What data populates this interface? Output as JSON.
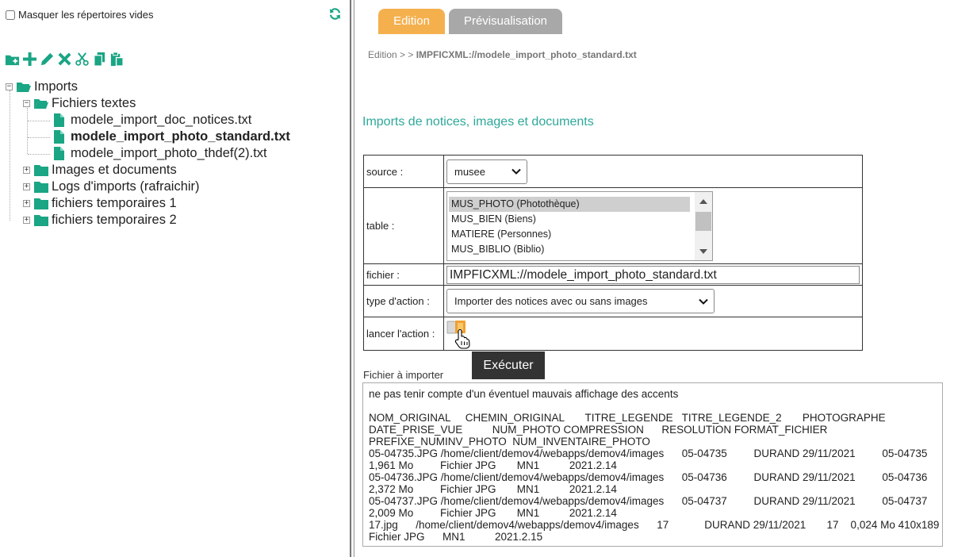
{
  "left_panel": {
    "hide_empty_label": "Masquer les répertoires vides",
    "toolbar_icons": [
      "new-folder-icon",
      "add-icon",
      "edit-icon",
      "delete-icon",
      "cut-icon",
      "copy-icon",
      "paste-icon"
    ],
    "tree": {
      "root": "Imports",
      "text_files_folder": "Fichiers textes",
      "files": [
        "modele_import_doc_notices.txt",
        "modele_import_photo_standard.txt",
        "modele_import_photo_thdef(2).txt"
      ],
      "other_folders": [
        "Images et documents",
        "Logs d'imports (rafraichir)",
        "fichiers temporaires 1",
        "fichiers temporaires 2"
      ]
    }
  },
  "tabs": {
    "edit": "Edition",
    "preview": "Prévisualisation"
  },
  "breadcrumb": {
    "prefix": "Edition > >",
    "current": "IMPFICXML://modele_import_photo_standard.txt"
  },
  "section_title": "Imports de notices, images et documents",
  "form": {
    "source_label": "source :",
    "source_value": "musee",
    "table_label": "table :",
    "table_options": [
      "MUS_PHOTO (Photothèque)",
      "MUS_BIEN (Biens)",
      "MATIERE (Personnes)",
      "MUS_BIBLIO (Biblio)"
    ],
    "file_label": "fichier :",
    "file_value": "IMPFICXML://modele_import_photo_standard.txt",
    "action_type_label": "type d'action :",
    "action_type_value": "Importer des notices avec ou sans images",
    "launch_label": "lancer l'action :"
  },
  "tooltip": "Exécuter",
  "file_to_import": {
    "label": "Fichier à importer",
    "lines": [
      "ne pas tenir compte d'un éventuel mauvais affichage des accents",
      "",
      "NOM_ORIGINAL     CHEMIN_ORIGINAL       TITRE_LEGENDE   TITRE_LEGENDE_2       PHOTOGRAPHE",
      "DATE_PRISE_VUE          NUM_PHOTO COMPRESSION      RESOLUTION FORMAT_FICHIER",
      "PREFIXE_NUMINV_PHOTO  NUM_INVENTAIRE_PHOTO",
      "05-04735.JPG /home/client/demov4/webapps/demov4/images      05-04735         DURAND 29/11/2021         05-04735",
      "1,961 Mo         Fichier JPG       MN1          2021.2.14",
      "05-04736.JPG /home/client/demov4/webapps/demov4/images      05-04736         DURAND 29/11/2021         05-04736",
      "2,372 Mo         Fichier JPG       MN1          2021.2.14",
      "05-04737.JPG /home/client/demov4/webapps/demov4/images      05-04737         DURAND 29/11/2021         05-04737",
      "2,009 Mo         Fichier JPG       MN1          2021.2.14",
      "17.jpg      /home/client/demov4/webapps/demov4/images      17            DURAND 29/11/2021       17    0,024 Mo 410x189",
      "Fichier JPG      MN1          2021.2.15"
    ]
  },
  "colors": {
    "accent_orange": "#f5b04e",
    "tab_gray": "#a8a8a8",
    "teal_title": "#2ea89a",
    "green_icons": "#1aa584"
  }
}
